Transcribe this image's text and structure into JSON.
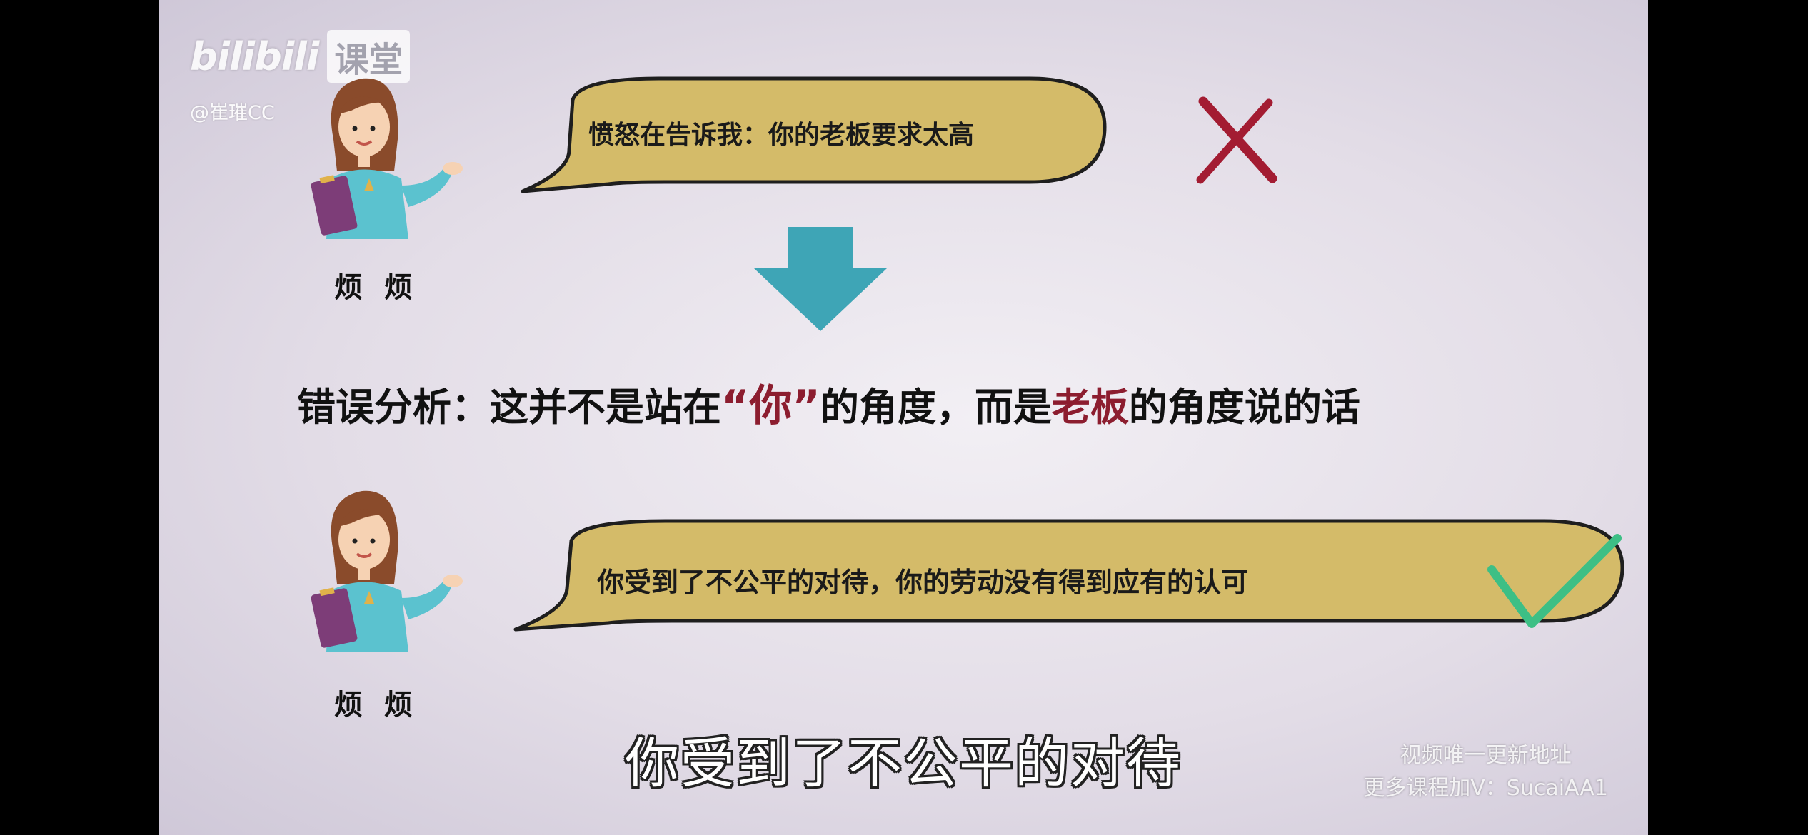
{
  "watermark": {
    "logo": "bilibili",
    "course": "课堂",
    "user": "@崔璀CC"
  },
  "character": {
    "name": "烦 烦"
  },
  "wrong_example": {
    "text": "愤怒在告诉我：你的老板要求太高",
    "mark_icon": "cross-icon",
    "mark_color": "#a31c32"
  },
  "analysis": {
    "prefix": "错误分析：这并不是站在",
    "open_quote": "“",
    "you": "你",
    "close_quote": "”",
    "middle": "的角度，而是",
    "boss": "老板",
    "suffix": "的角度说的话",
    "highlight_color": "#8c1d2f"
  },
  "right_example": {
    "text": "你受到了不公平的对待，你的劳动没有得到应有的认可",
    "mark_icon": "check-icon",
    "mark_color": "#3dbf85"
  },
  "subtitle": "你受到了不公平的对待",
  "footer_watermark": {
    "line1": "视频唯一更新地址",
    "line2": "更多课程加V：SucaiAA1"
  },
  "colors": {
    "bubble_fill": "#d4bb69",
    "bubble_outline": "#1e1e1e",
    "arrow": "#3ea5b6"
  }
}
